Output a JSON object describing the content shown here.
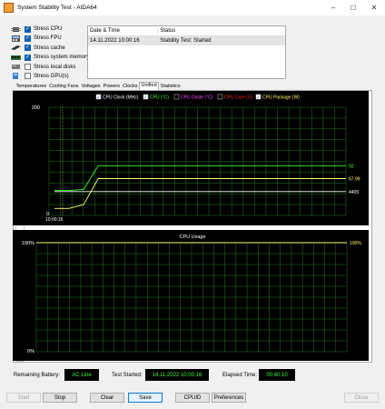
{
  "window": {
    "title": "System Stability Test - AIDA64",
    "minimize": "–",
    "maximize": "☐",
    "close": "✕"
  },
  "stress_options": [
    {
      "label": "Stress CPU",
      "checked": true,
      "icon": "cpu-icon"
    },
    {
      "label": "Stress FPU",
      "checked": true,
      "icon": "fpu-icon"
    },
    {
      "label": "Stress cache",
      "checked": true,
      "icon": "cache-icon"
    },
    {
      "label": "Stress system memory",
      "checked": true,
      "icon": "memory-icon"
    },
    {
      "label": "Stress local disks",
      "checked": false,
      "icon": "disk-icon"
    },
    {
      "label": "Stress GPU(s)",
      "checked": false,
      "icon": "gpu-icon"
    }
  ],
  "status_table": {
    "headers": [
      "Date & Time",
      "Status"
    ],
    "rows": [
      [
        "14.11.2022 10:00:16",
        "Stability Test: Started"
      ]
    ]
  },
  "tabs": [
    "Temperatures",
    "Cooling Fans",
    "Voltages",
    "Powers",
    "Clocks",
    "Unified",
    "Statistics"
  ],
  "active_tab": "Unified",
  "chart_data": [
    {
      "type": "line",
      "legend": [
        {
          "name": "CPU Clock (MHz)",
          "color": "#ffffff",
          "checked": true
        },
        {
          "name": "CPU (°C)",
          "color": "#3cff3c",
          "checked": true
        },
        {
          "name": "CPU Diode (°C)",
          "color": "#ff44ff",
          "checked": false
        },
        {
          "name": "CPU Core (V)",
          "color": "#ff3030",
          "checked": false
        },
        {
          "name": "CPU Package (W)",
          "color": "#ffff66",
          "checked": true
        }
      ],
      "y_max_label": "200",
      "y_min_label": "0",
      "ylim": [
        0,
        200
      ],
      "x_start_label": "10:00:16",
      "series": [
        {
          "name": "CPU (°C)",
          "color": "#3cff3c",
          "values": [
            46,
            46,
            48,
            92,
            92,
            92,
            92,
            92,
            92,
            92,
            92,
            92,
            92,
            92,
            92,
            92,
            92,
            92,
            92,
            92,
            92
          ]
        },
        {
          "name": "CPU Package (W)",
          "color": "#ffff66",
          "values": [
            13,
            13,
            20,
            68,
            68,
            68,
            68,
            68,
            68,
            68,
            68,
            68,
            68,
            68,
            68,
            68,
            68,
            68,
            68,
            68,
            68
          ]
        },
        {
          "name": "CPU Clock (MHz)",
          "color": "#ffffff",
          "values": [
            44,
            44,
            44,
            44,
            44,
            44,
            44,
            44,
            44,
            44,
            44,
            44,
            44,
            44,
            44,
            44,
            44,
            44,
            44,
            44,
            44
          ]
        }
      ],
      "end_labels": [
        "92",
        "67.99",
        "4405"
      ]
    },
    {
      "type": "line",
      "title": "CPU Usage",
      "y_max_label": "100%",
      "y_min_label": "0%",
      "ylim": [
        0,
        100
      ],
      "series": [
        {
          "name": "CPU Usage",
          "color": "#ffff66",
          "values": [
            100,
            100,
            100,
            100,
            100,
            100,
            100,
            100,
            100,
            100
          ]
        }
      ],
      "end_labels": [
        "100%"
      ]
    }
  ],
  "bottom": {
    "remaining_battery_label": "Remaining Battery:",
    "remaining_battery_value": "AC Line",
    "test_started_label": "Test Started:",
    "test_started_value": "14.11.2022 10:00:16",
    "elapsed_label": "Elapsed Time:",
    "elapsed_value": "00:40:10"
  },
  "buttons": {
    "start": "Start",
    "stop": "Stop",
    "clear": "Clear",
    "save": "Save",
    "cpuid": "CPUID",
    "preferences": "Preferences",
    "close": "Close"
  }
}
